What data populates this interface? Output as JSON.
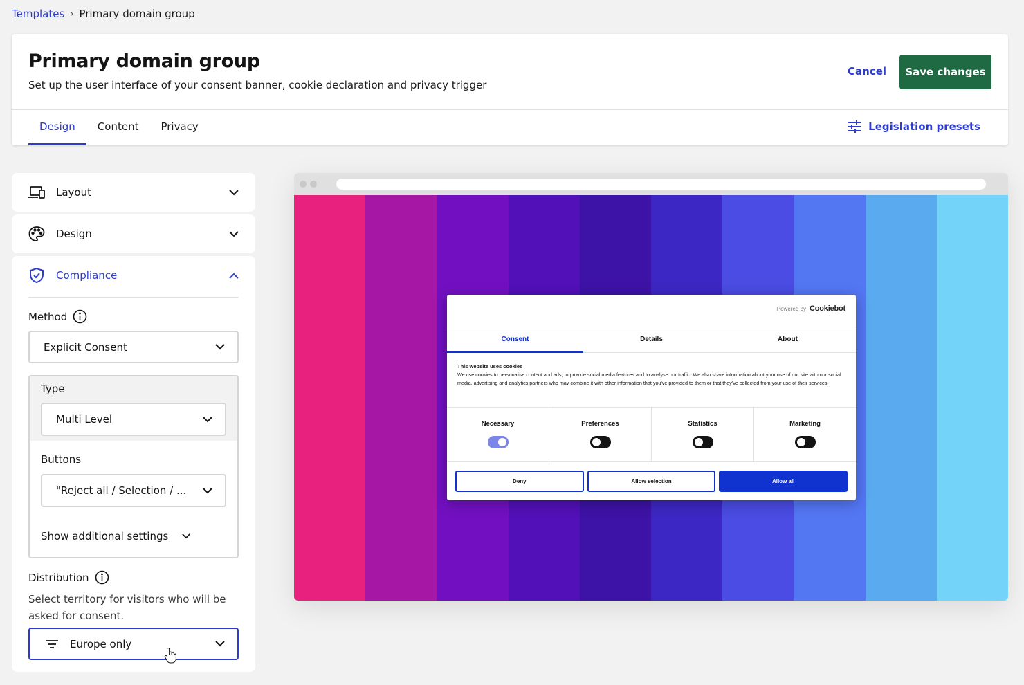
{
  "breadcrumb": {
    "root": "Templates",
    "separator": "›",
    "current": "Primary domain group"
  },
  "header": {
    "title": "Primary domain group",
    "subtitle": "Set up the user interface of your consent banner, cookie declaration and privacy trigger",
    "cancel_label": "Cancel",
    "save_label": "Save changes",
    "tabs": [
      {
        "label": "Design"
      },
      {
        "label": "Content"
      },
      {
        "label": "Privacy"
      }
    ],
    "presets_label": "Legislation presets"
  },
  "sidebar": {
    "layout_label": "Layout",
    "design_label": "Design",
    "compliance_label": "Compliance",
    "method_label": "Method",
    "method_value": "Explicit Consent",
    "type_label": "Type",
    "type_value": "Multi Level",
    "buttons_label": "Buttons",
    "buttons_value": "\"Reject all / Selection / ...",
    "additional_label": "Show additional settings",
    "distribution_label": "Distribution",
    "distribution_help": "Select territory for visitors who will be asked for consent.",
    "distribution_value": "Europe only"
  },
  "preview": {
    "stripes": [
      "#e8217e",
      "#a617a6",
      "#7210c1",
      "#5210b8",
      "#3d12a6",
      "#3d27c4",
      "#4a4ce3",
      "#5376f3",
      "#5aaaf0",
      "#74d3f9"
    ],
    "banner": {
      "powered_by": "Powered by",
      "brand": "Cookiebot",
      "tabs": [
        {
          "label": "Consent"
        },
        {
          "label": "Details"
        },
        {
          "label": "About"
        }
      ],
      "heading": "This website uses cookies",
      "body": "We use cookies to personalise content and ads, to provide social media features and to analyse our traffic. We also share information about your use of our site with our social media, advertising and analytics partners who may combine it with other information that you've provided to them or that they've collected from your use of their services.",
      "categories": [
        {
          "name": "Necessary",
          "on": true
        },
        {
          "name": "Preferences",
          "on": false
        },
        {
          "name": "Statistics",
          "on": false
        },
        {
          "name": "Marketing",
          "on": false
        }
      ],
      "deny_label": "Deny",
      "selection_label": "Allow selection",
      "allow_label": "Allow all"
    }
  }
}
